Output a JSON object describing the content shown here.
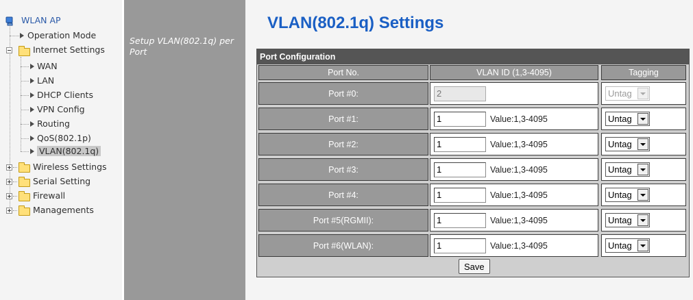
{
  "tree": {
    "root": "WLAN AP",
    "operation_mode": "Operation Mode",
    "internet_settings": "Internet Settings",
    "internet_children": [
      "WAN",
      "LAN",
      "DHCP Clients",
      "VPN Config",
      "Routing",
      "QoS(802.1p)",
      "VLAN(802.1q)"
    ],
    "wireless_settings": "Wireless Settings",
    "serial_setting": "Serial Setting",
    "firewall": "Firewall",
    "managements": "Managements"
  },
  "sidebar_desc": "Setup VLAN(802.1q) per Port",
  "page_title": "VLAN(802.1q) Settings",
  "config": {
    "title": "Port Configuration",
    "headers": {
      "port": "Port No.",
      "vlan": "VLAN ID (1,3-4095)",
      "tagging": "Tagging"
    },
    "hint": "Value:1,3-4095",
    "ports": [
      {
        "label": "Port #0:",
        "vlan": "2",
        "tag": "Untag",
        "disabled": true
      },
      {
        "label": "Port #1:",
        "vlan": "1",
        "tag": "Untag",
        "disabled": false
      },
      {
        "label": "Port #2:",
        "vlan": "1",
        "tag": "Untag",
        "disabled": false
      },
      {
        "label": "Port #3:",
        "vlan": "1",
        "tag": "Untag",
        "disabled": false
      },
      {
        "label": "Port #4:",
        "vlan": "1",
        "tag": "Untag",
        "disabled": false
      },
      {
        "label": "Port #5(RGMII):",
        "vlan": "1",
        "tag": "Untag",
        "disabled": false
      },
      {
        "label": "Port #6(WLAN):",
        "vlan": "1",
        "tag": "Untag",
        "disabled": false
      }
    ],
    "save_label": "Save"
  },
  "colors": {
    "title_blue": "#1a5fc4",
    "middle_panel": "#999999",
    "header_bar": "#555555"
  },
  "icons": {
    "root": "computer-icon",
    "folder": "folder-icon",
    "leaf": "arrow-right-icon",
    "expander": "tree-expander-icon"
  }
}
